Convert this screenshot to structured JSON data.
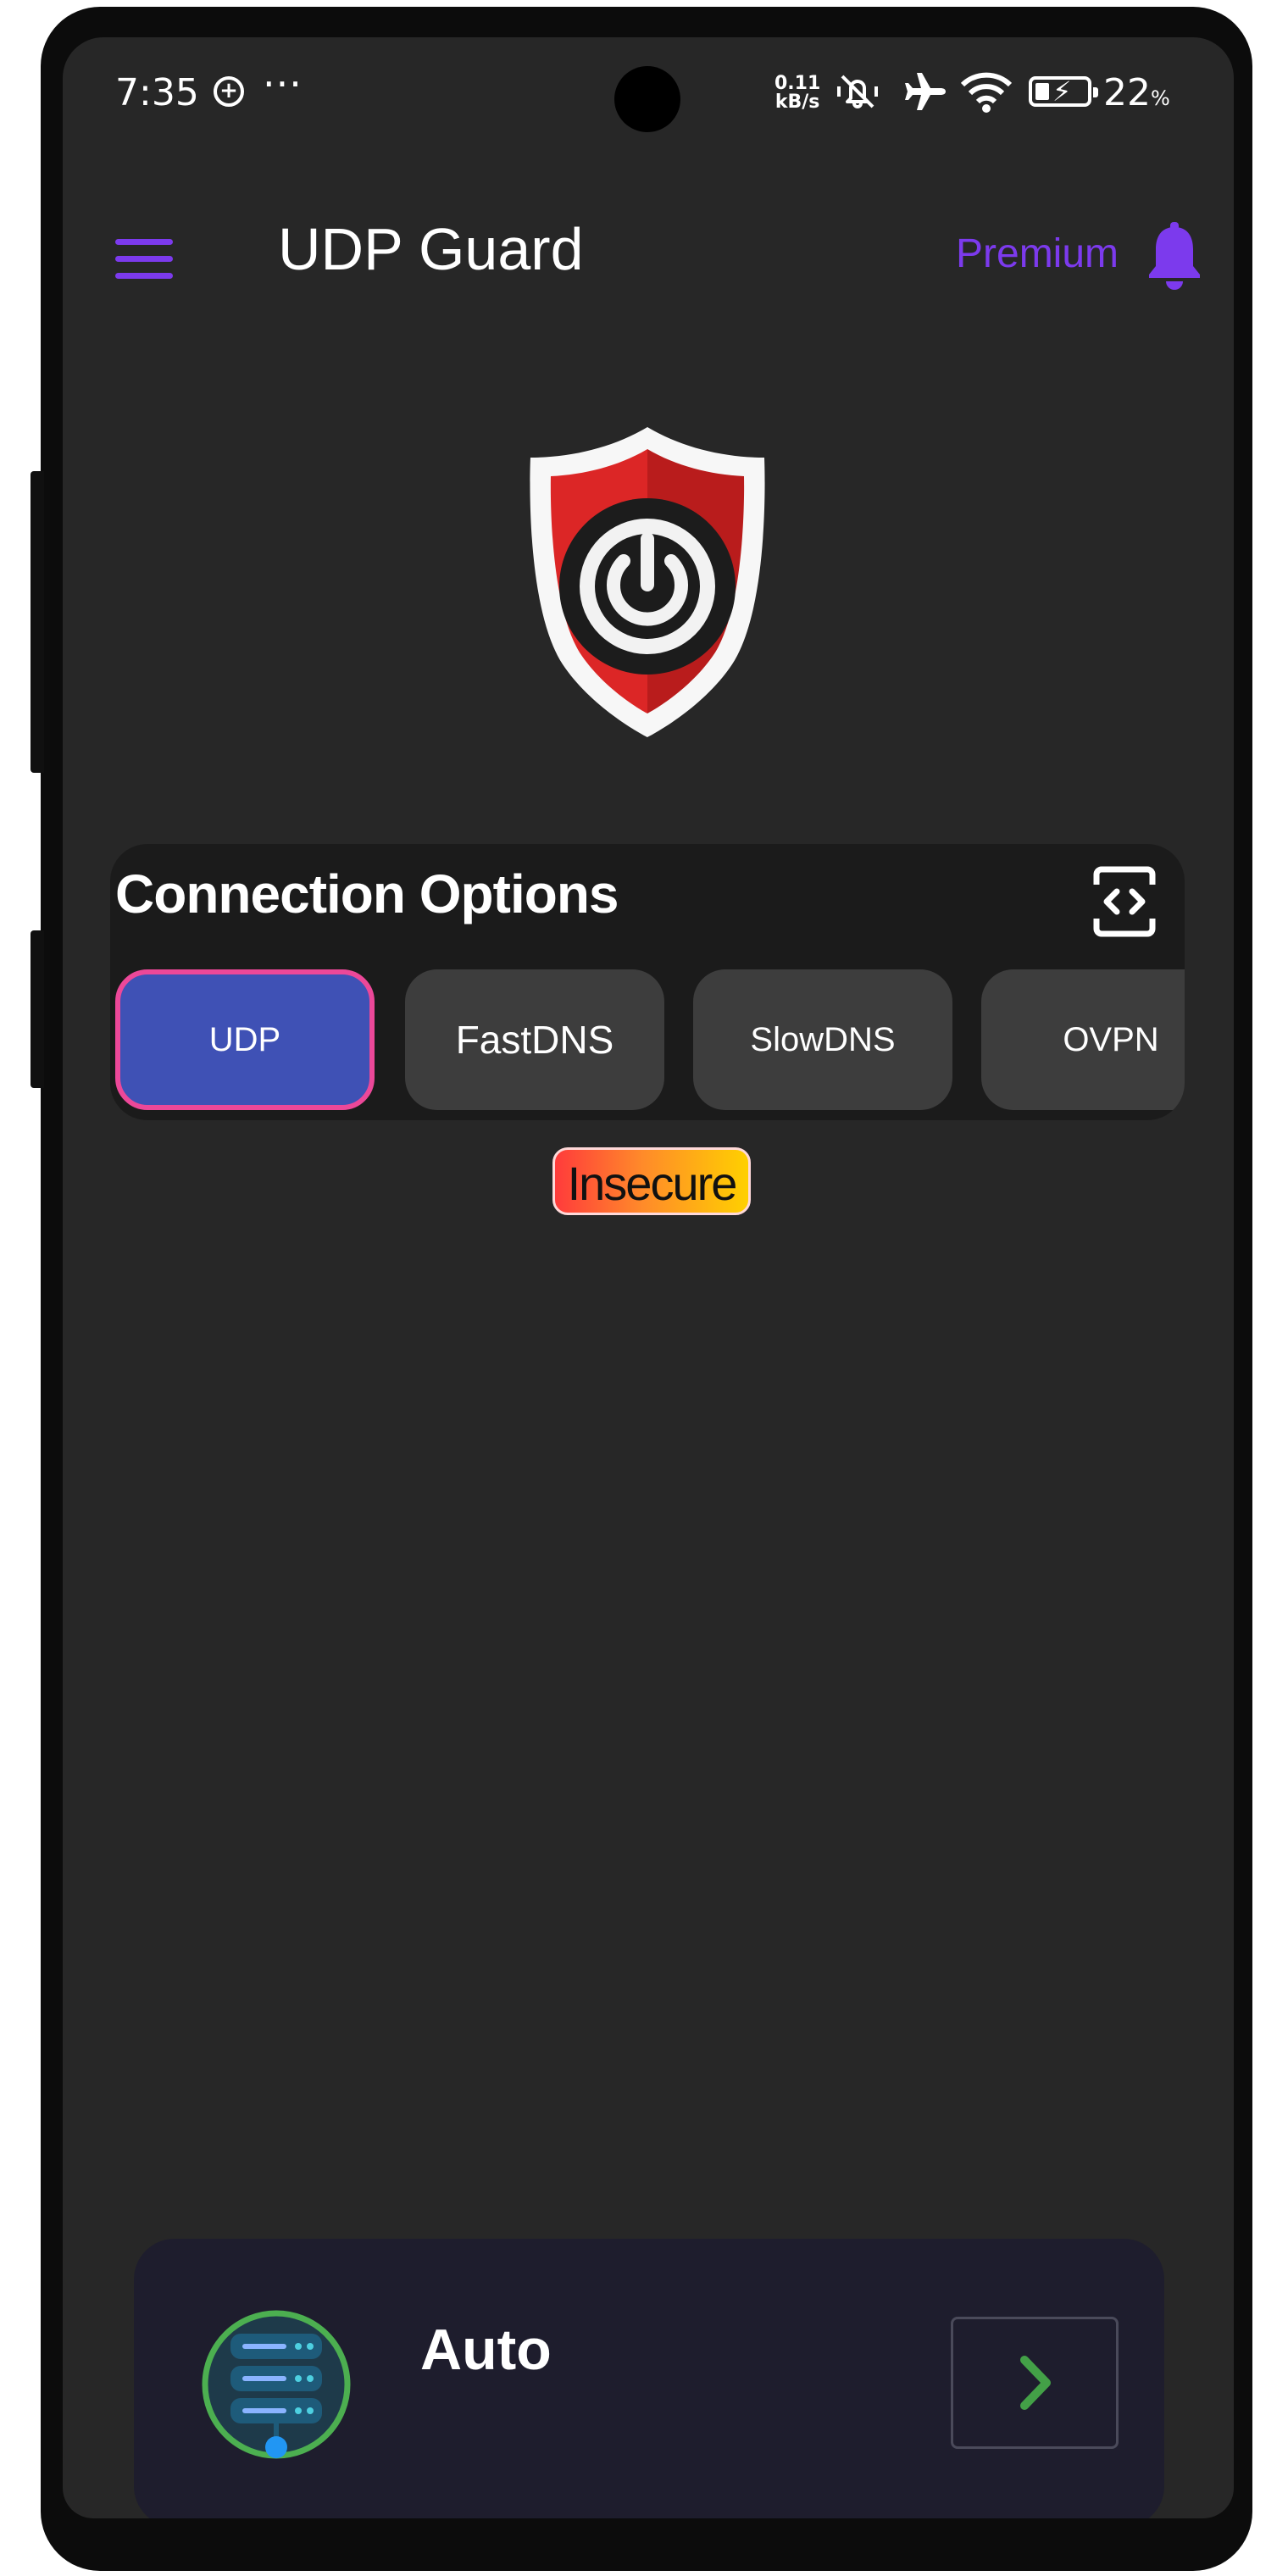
{
  "status_bar": {
    "time": "7:35",
    "speed_value": "0.11",
    "speed_unit": "kB/s",
    "battery_percent": "22",
    "battery_unit": "%"
  },
  "app_bar": {
    "title": "UDP Guard",
    "premium_label": "Premium"
  },
  "connection": {
    "title": "Connection Options",
    "tabs": [
      {
        "label": "UDP",
        "active": true
      },
      {
        "label": "FastDNS",
        "active": false
      },
      {
        "label": "SlowDNS",
        "active": false
      },
      {
        "label": "OVPN",
        "active": false
      }
    ],
    "security_badge": "Insecure"
  },
  "server": {
    "name": "Auto"
  },
  "colors": {
    "accent": "#7c3aed",
    "active_tab": "#3f51b5",
    "active_tab_border": "#ec4899",
    "server_ring": "#4caf50",
    "arrow": "#43a047",
    "shield_red": "#dc2626"
  },
  "icons": {
    "menu": "hamburger-menu-icon",
    "bell": "notification-bell-icon",
    "shield": "shield-power-icon",
    "scan": "scan-code-icon",
    "server": "server-stack-icon",
    "arrow": "chevron-right-icon"
  }
}
